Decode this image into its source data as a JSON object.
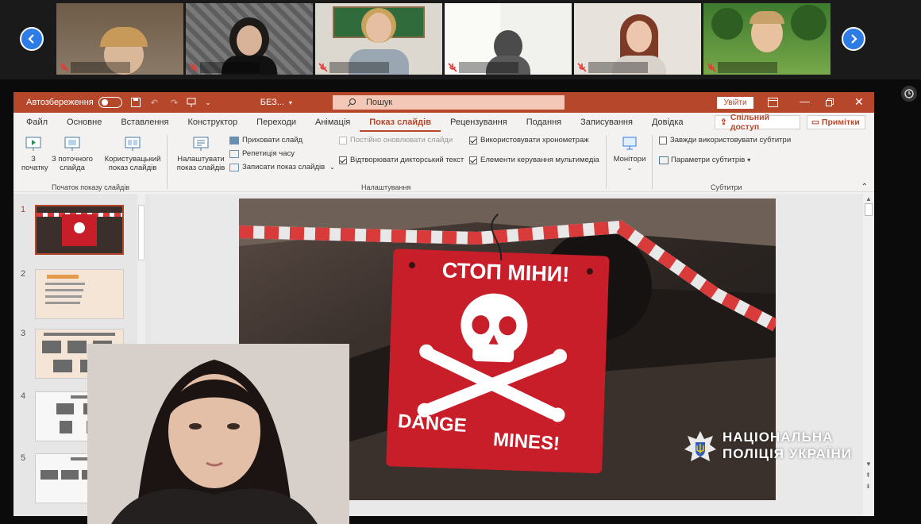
{
  "meeting": {
    "participants": [
      {
        "name": "",
        "muted": true
      },
      {
        "name": "",
        "muted": true
      },
      {
        "name": "",
        "muted": true
      },
      {
        "name": "",
        "muted": true
      },
      {
        "name": "",
        "muted": true
      },
      {
        "name": "",
        "muted": true
      }
    ]
  },
  "ppt": {
    "autosave_label": "Автозбереження",
    "file_title": "БЕЗ...",
    "search_placeholder": "Пошук",
    "signin_label": "Увійти",
    "menu": [
      "Файл",
      "Основне",
      "Вставлення",
      "Конструктор",
      "Переходи",
      "Анімація",
      "Показ слайдів",
      "Рецензування",
      "Подання",
      "Записування",
      "Довідка"
    ],
    "active_tab": "Показ слайдів",
    "share_label": "Спільний доступ",
    "comments_label": "Примітки",
    "ribbon": {
      "from_start": "З початку",
      "from_current": "З поточного слайда",
      "custom_show": "Користувацький показ слайдів",
      "group_start": "Початок показу слайдів",
      "setup_show": "Налаштувати показ слайдів",
      "hide_slide": "Приховати слайд",
      "rehearse": "Репетиція часу",
      "record": "Записати показ слайдів",
      "keep_updated": "Постійно оновлювати слайди",
      "play_narrations": "Відтворювати дикторський текст",
      "use_timings": "Використовувати хронометраж",
      "media_controls": "Елементи керування мультимедіа",
      "group_setup": "Налаштування",
      "monitors": "Монітори",
      "always_subtitles": "Завжди використовувати субтитри",
      "subtitle_settings": "Параметри субтитрів",
      "group_subtitles": "Субтитри"
    },
    "slide_numbers": [
      "1",
      "2",
      "3",
      "4",
      "5"
    ],
    "slide": {
      "sign_top": "СТОП МІНИ!",
      "sign_bottom_left": "DANGE",
      "sign_bottom_right": "MINES!",
      "watermark_line1": "НАЦІОНАЛЬНА",
      "watermark_line2": "ПОЛІЦІЯ УКРАЇНИ"
    }
  },
  "colors": {
    "accent": "#b7472a",
    "zoom_blue": "#2d7be5",
    "sign_red": "#c81e2a"
  }
}
